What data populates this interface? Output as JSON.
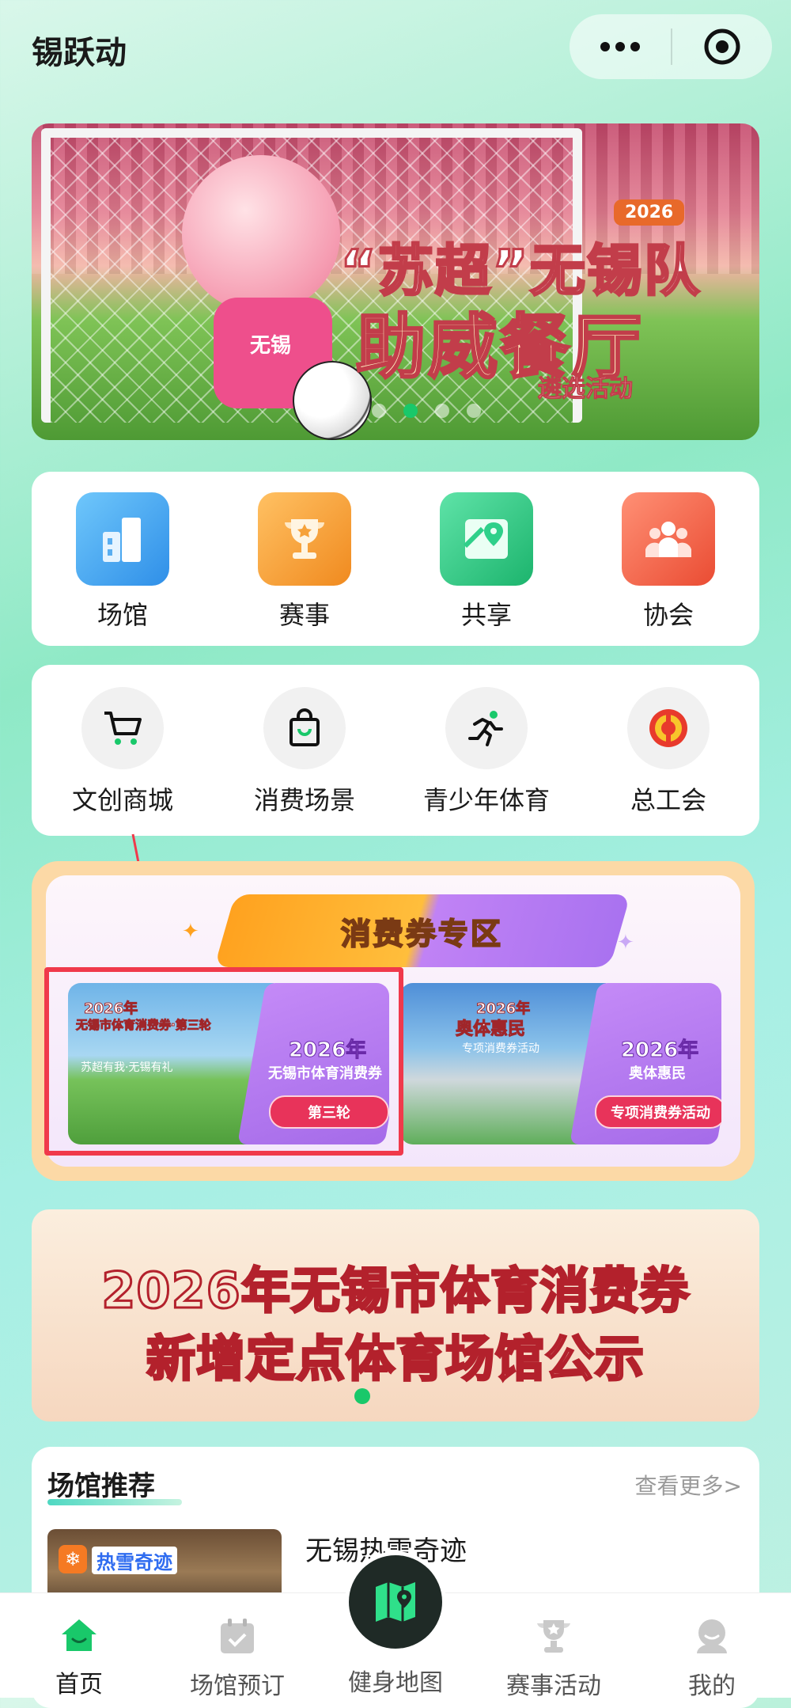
{
  "header": {
    "title": "锡跃动",
    "menu_icon": "more-dots-icon",
    "close_icon": "target-icon"
  },
  "banner": {
    "year_tag": "2026",
    "line1": "“苏超”无锡队",
    "line2": "助威餐厅",
    "line3": "遴选活动",
    "mascot_shirt": "无锡",
    "carousel_dots": 4,
    "carousel_active": 2
  },
  "main_nav": [
    {
      "label": "场馆",
      "icon": "building-icon",
      "color": "#3fa3f0"
    },
    {
      "label": "赛事",
      "icon": "trophy-icon",
      "color": "#f8a13a"
    },
    {
      "label": "共享",
      "icon": "map-pin-icon",
      "color": "#2fd08a"
    },
    {
      "label": "协会",
      "icon": "people-icon",
      "color": "#f26a4f"
    }
  ],
  "sub_nav": [
    {
      "label": "文创商城",
      "icon": "cart-icon"
    },
    {
      "label": "消费场景",
      "icon": "shopping-bag-icon"
    },
    {
      "label": "青少年体育",
      "icon": "runner-icon"
    },
    {
      "label": "总工会",
      "icon": "union-emblem-icon"
    }
  ],
  "voucher": {
    "title": "消费券专区",
    "cards": [
      {
        "pic_line1": "2026年",
        "pic_line2": "无锡市体育消费券·第三轮",
        "pic_line3": "苏超有我·无锡有礼",
        "side_line1": "2026年",
        "side_line2": "无锡市体育消费券",
        "pill": "第三轮"
      },
      {
        "pic_line1": "2026年",
        "pic_line2": "奥体惠民",
        "pic_line3": "专项消费券活动",
        "side_line1": "2026年",
        "side_line2": "奥体惠民",
        "pill": "专项消费券活动"
      }
    ]
  },
  "notice": {
    "line1": "2026年无锡市体育消费券",
    "line2": "新增定点体育场馆公示"
  },
  "venues": {
    "title": "场馆推荐",
    "more": "查看更多>",
    "items": [
      {
        "name": "无锡热雪奇迹",
        "img_logo": "热雪奇迹"
      }
    ]
  },
  "tabbar": [
    {
      "label": "首页",
      "icon": "home-icon",
      "active": true
    },
    {
      "label": "场馆预订",
      "icon": "calendar-check-icon",
      "active": false
    },
    {
      "label": "健身地图",
      "icon": "fitness-map-icon",
      "active": false
    },
    {
      "label": "赛事活动",
      "icon": "trophy-icon",
      "active": false
    },
    {
      "label": "我的",
      "icon": "profile-icon",
      "active": false
    }
  ],
  "colors": {
    "accent_green": "#19c86a",
    "highlight_red": "#f0394b"
  }
}
